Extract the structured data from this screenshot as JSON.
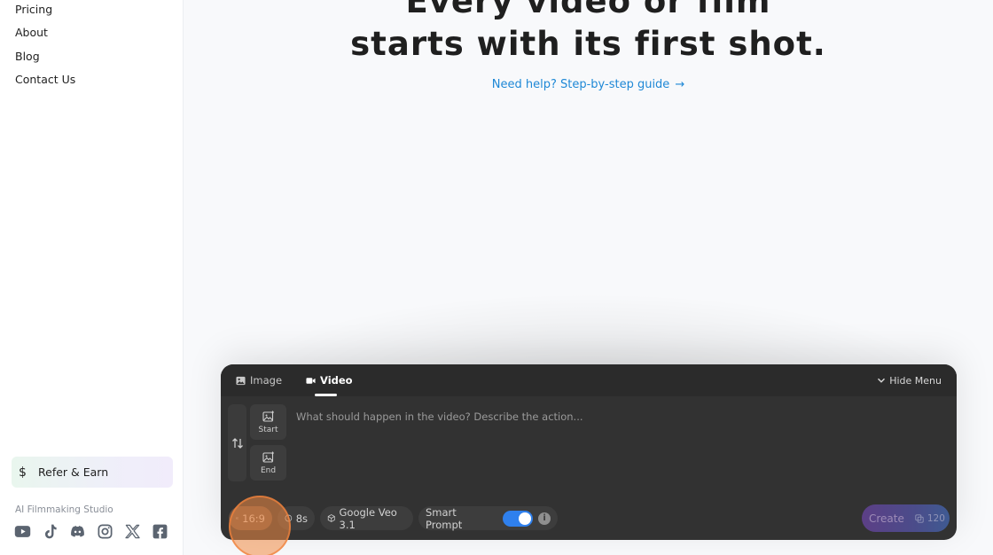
{
  "sidebar": {
    "nav": [
      {
        "label": "Pricing"
      },
      {
        "label": "About"
      },
      {
        "label": "Blog"
      },
      {
        "label": "Contact Us"
      }
    ],
    "refer": {
      "icon": "dollar-icon",
      "symbol": "$",
      "label": "Refer & Earn"
    },
    "tagline": "AI Filmmaking Studio",
    "socials": [
      "youtube-icon",
      "tiktok-icon",
      "discord-icon",
      "instagram-icon",
      "x-icon",
      "facebook-icon"
    ]
  },
  "hero": {
    "line1": "Every video or film",
    "line2": "starts with its first shot.",
    "help_link": "Need help? Step-by-step guide",
    "help_arrow": "→"
  },
  "composer": {
    "tabs": [
      {
        "label": "Image",
        "icon": "image-icon",
        "active": false
      },
      {
        "label": "Video",
        "icon": "video-camera-icon",
        "active": true
      }
    ],
    "hide_menu": "Hide Menu",
    "frames": {
      "start": "Start",
      "end": "End"
    },
    "prompt_placeholder": "What should happen in the video? Describe the action...",
    "options": {
      "aspect": "16:9",
      "duration": "8s",
      "model": "Google Veo 3.1",
      "smart_prompt": "Smart Prompt",
      "smart_prompt_enabled": true,
      "info": "i"
    },
    "create": {
      "label": "Create",
      "cost": "120"
    }
  },
  "colors": {
    "accent_blue": "#1e88d6",
    "panel": "#323232",
    "toggle_on": "#2f80ed",
    "cursor_highlight": "#f38c46"
  }
}
